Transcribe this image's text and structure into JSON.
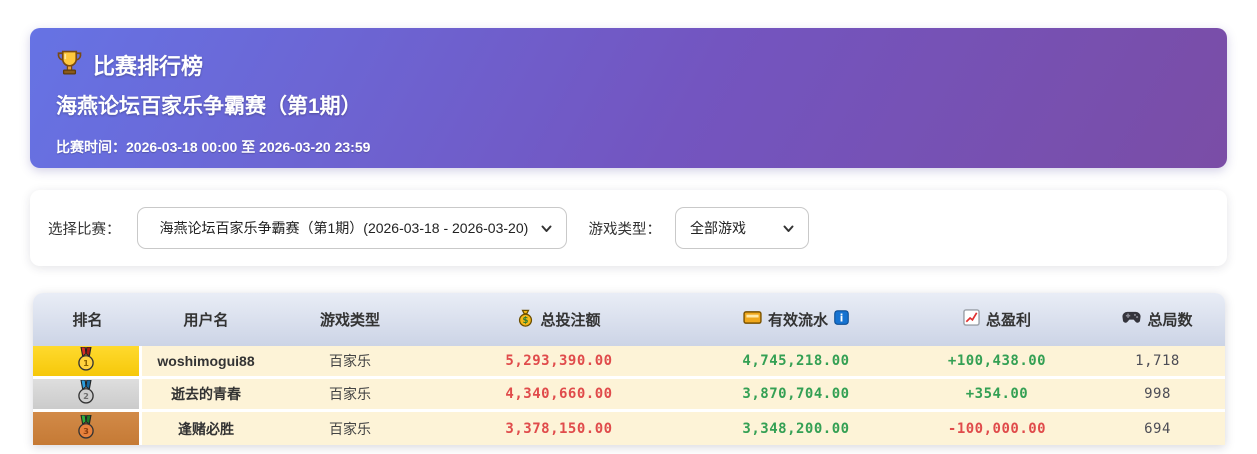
{
  "hero": {
    "title": "比赛排行榜",
    "subtitle": "海燕论坛百家乐争霸赛（第1期）",
    "time": "比赛时间：2026-03-18 00:00 至 2026-03-20 23:59"
  },
  "filters": {
    "competition_label": "选择比赛：",
    "competition_value": "海燕论坛百家乐争霸赛（第1期）(2026-03-18 - 2026-03-20)",
    "game_type_label": "游戏类型：",
    "game_type_value": "全部游戏"
  },
  "table": {
    "headers": {
      "rank": "排名",
      "username": "用户名",
      "game_type": "游戏类型",
      "total_bet": "总投注额",
      "turnover": "有效流水",
      "profit": "总盈利",
      "rounds": "总局数"
    },
    "rows": [
      {
        "rank": 1,
        "medal": "gold-medal-icon",
        "username": "woshimogui88",
        "game_type": "百家乐",
        "total_bet": "5,293,390.00",
        "turnover": "4,745,218.00",
        "profit": "+100,438.00",
        "rounds": "1,718"
      },
      {
        "rank": 2,
        "medal": "silver-medal-icon",
        "username": "逝去的青春",
        "game_type": "百家乐",
        "total_bet": "4,340,660.00",
        "turnover": "3,870,704.00",
        "profit": "+354.00",
        "rounds": "998"
      },
      {
        "rank": 3,
        "medal": "bronze-medal-icon",
        "username": "逢赌必胜",
        "game_type": "百家乐",
        "total_bet": "3,378,150.00",
        "turnover": "3,348,200.00",
        "profit": "-100,000.00",
        "rounds": "694"
      }
    ]
  },
  "icons": {
    "hero": "trophy-icon",
    "total_bet": "money-bag-icon",
    "turnover": "credit-card-icon",
    "turnover_hint": "info-icon",
    "profit": "chart-up-icon",
    "rounds": "gamepad-icon",
    "select": "chevron-down-icon"
  },
  "colors": {
    "hero_gradient_start": "#6673e4",
    "hero_gradient_end": "#7a4da6",
    "row_bg": "#fdf3d7",
    "header_bg": "#ccd4e6",
    "gold": "#f6c80a",
    "silver": "#cbcbcb",
    "bronze": "#c57a35",
    "negative_red": "#e04b4b",
    "positive_green": "#34a054"
  }
}
